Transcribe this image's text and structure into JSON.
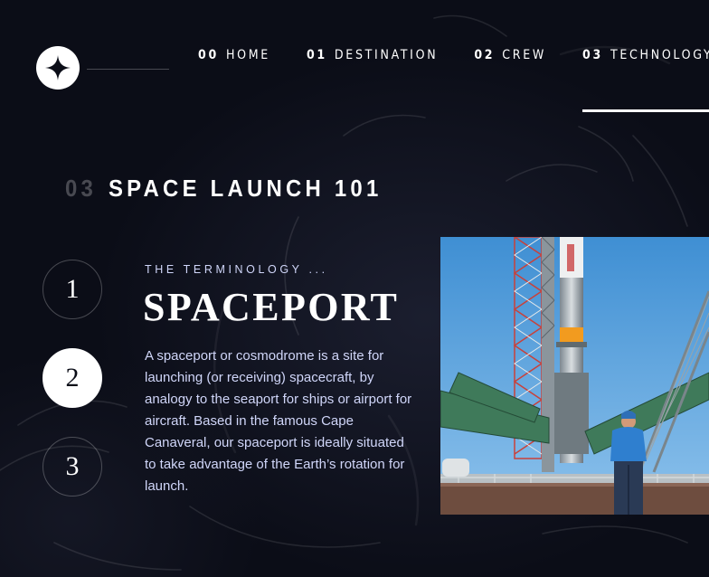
{
  "nav": {
    "items": [
      {
        "num": "00",
        "label": "HOME"
      },
      {
        "num": "01",
        "label": "DESTINATION"
      },
      {
        "num": "02",
        "label": "CREW"
      },
      {
        "num": "03",
        "label": "TECHNOLOGY"
      }
    ],
    "active_index": 3
  },
  "heading": {
    "num": "03",
    "label": "SPACE LAUNCH 101"
  },
  "steps": [
    {
      "label": "1"
    },
    {
      "label": "2"
    },
    {
      "label": "3"
    }
  ],
  "active_step": 2,
  "content": {
    "eyebrow": "THE TERMINOLOGY ...",
    "title": "SPACEPORT",
    "description": "A spaceport or cosmodrome is a site for launching (or receiving) spacecraft, by analogy to the seaport for ships or airport for aircraft. Based in the famous Cape Canaveral, our spaceport is ideally situated to take advantage of the Earth’s rotation for launch."
  },
  "colors": {
    "background": "#0b0d17",
    "accent_text": "#d0d6f9",
    "white": "#ffffff"
  },
  "icons": {
    "logo": "four-point-star-icon"
  }
}
